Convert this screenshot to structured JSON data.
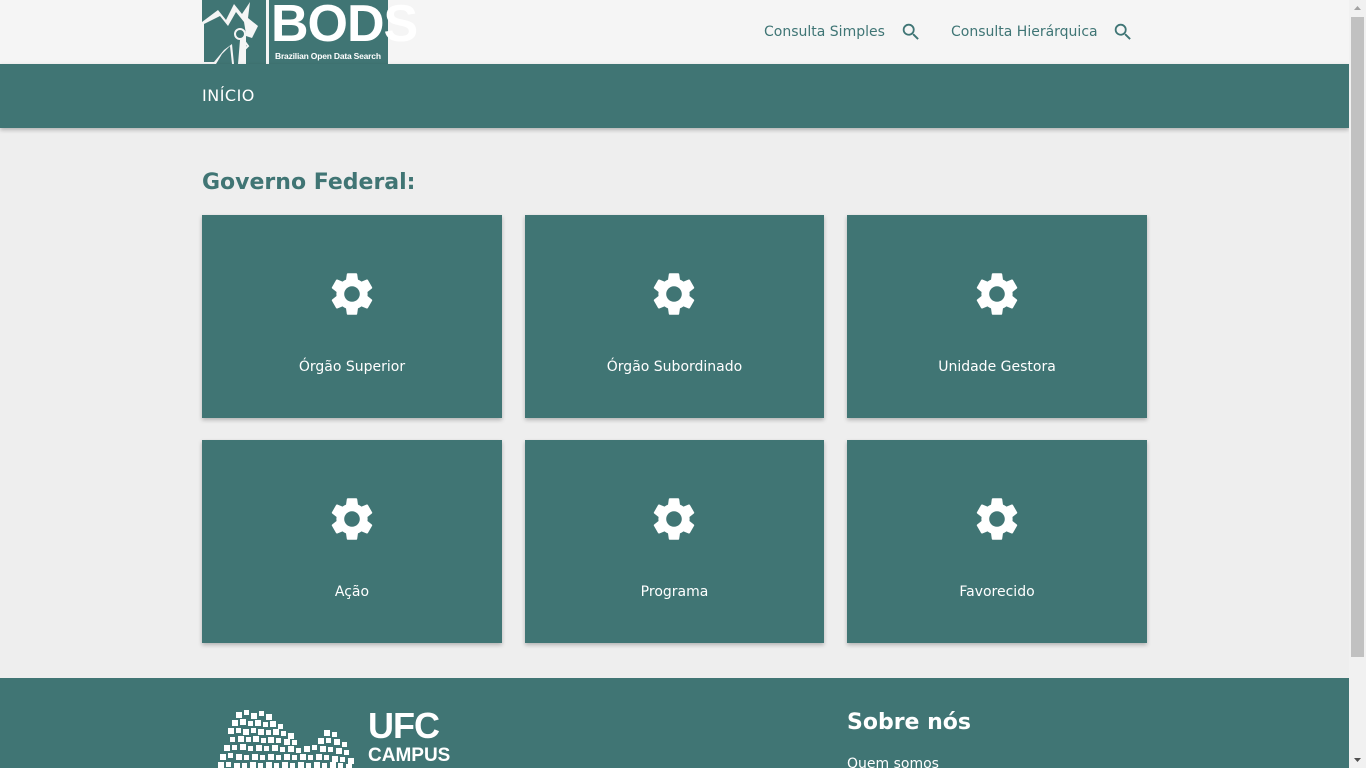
{
  "header": {
    "logo": {
      "title": "BODS",
      "subtitle": "Brazilian Open Data Search"
    },
    "nav": [
      {
        "label": "Consulta Simples",
        "icon": "search-icon"
      },
      {
        "label": "Consulta Hierárquica",
        "icon": "search-icon"
      }
    ]
  },
  "breadcrumb": {
    "title": "INÍCIO"
  },
  "main": {
    "section_title": "Governo Federal:",
    "cards": [
      {
        "label": "Órgão Superior",
        "icon": "gear-icon"
      },
      {
        "label": "Órgão Subordinado",
        "icon": "gear-icon"
      },
      {
        "label": "Unidade Gestora",
        "icon": "gear-icon"
      },
      {
        "label": "Ação",
        "icon": "gear-icon"
      },
      {
        "label": "Programa",
        "icon": "gear-icon"
      },
      {
        "label": "Favorecido",
        "icon": "gear-icon"
      }
    ]
  },
  "footer": {
    "logo": {
      "line1": "UFC",
      "line2": "CAMPUS"
    },
    "about_title": "Sobre nós",
    "about_link": "Quem somos"
  },
  "colors": {
    "primary": "#407574",
    "background": "#eeeeee",
    "header_bg": "#f5f5f5",
    "text_on_primary": "#ffffff"
  }
}
